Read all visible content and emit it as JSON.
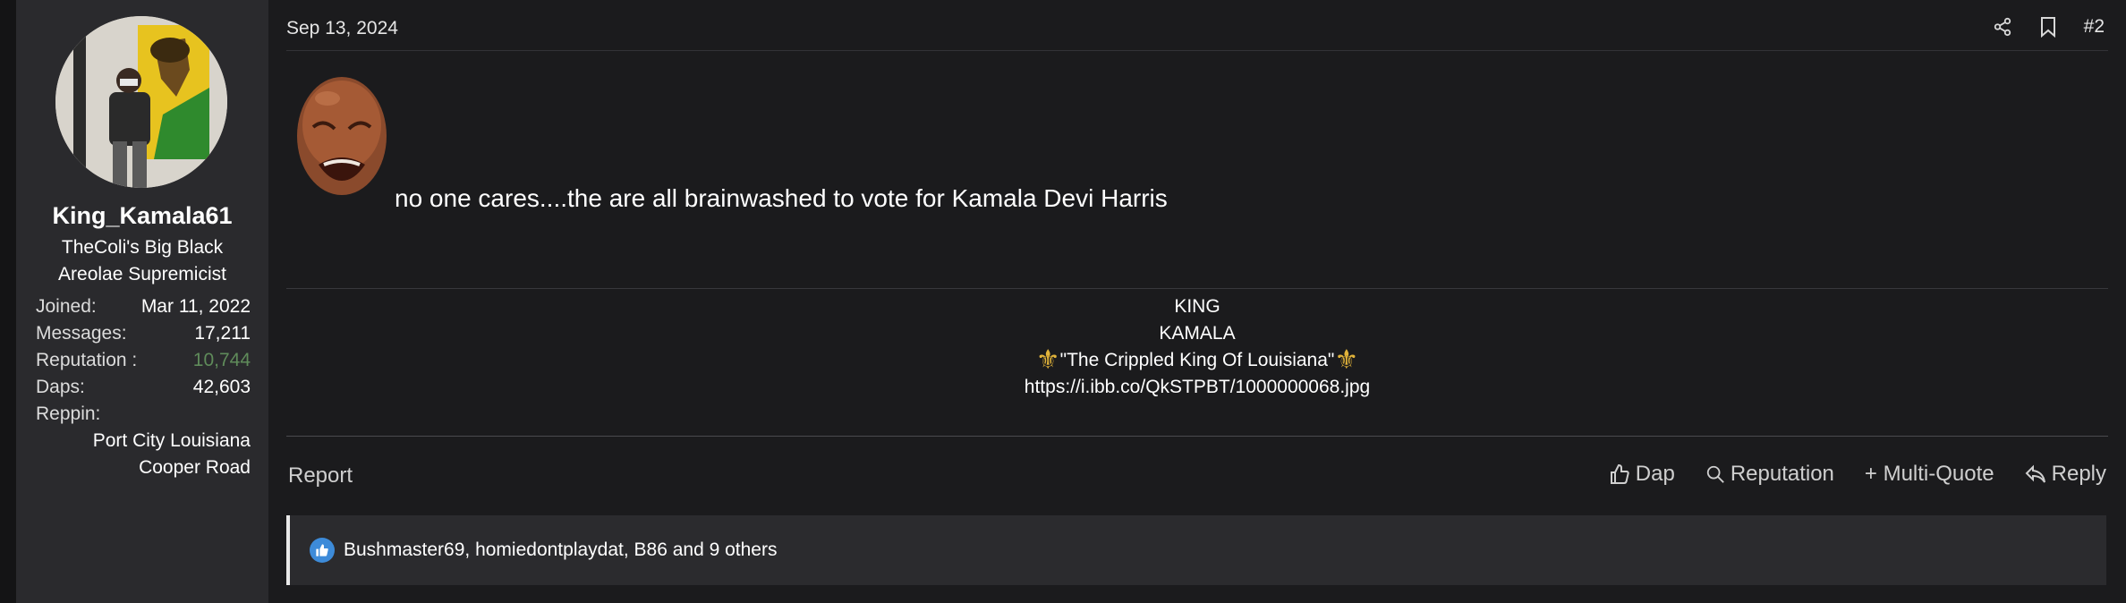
{
  "post": {
    "date": "Sep 13, 2024",
    "number": "#2",
    "body_text": "no one cares....the are all brainwashed to vote for Kamala Devi Harris",
    "emoji": "crying-jordan-face"
  },
  "user": {
    "name": "King_Kamala61",
    "title_line1": "TheColi's Big Black",
    "title_line2": "Areolae Supremicist",
    "joined_label": "Joined:",
    "joined_value": "Mar 11, 2022",
    "messages_label": "Messages:",
    "messages_value": "17,211",
    "reputation_label": "Reputation :",
    "reputation_value": "10,744",
    "daps_label": "Daps:",
    "daps_value": "42,603",
    "reppin_label": "Reppin:",
    "reppin_line1": "Port City Louisiana",
    "reppin_line2": "Cooper Road"
  },
  "signature": {
    "line1": "KING",
    "line2": "KAMALA",
    "line3": "\"The Crippled King Of Louisiana\"",
    "line4": "https://i.ibb.co/QkSTPBT/1000000068.jpg"
  },
  "footer": {
    "report_label": "Report",
    "dap_label": "Dap",
    "reputation_label": "Reputation",
    "multiquote_label": "+ Multi-Quote",
    "reply_label": "Reply"
  },
  "reactions": {
    "text": "Bushmaster69, homiedontplaydat, B86 and 9 others"
  },
  "colors": {
    "background": "#1b1b1d",
    "panel": "#2a2a2d",
    "reputation_green": "#5f8b5a",
    "like_blue": "#3d8bd9",
    "fleur_gold": "#e1b33a"
  },
  "icons": [
    "share-icon",
    "bookmark-icon",
    "thumbs-up-icon",
    "search-icon",
    "reply-icon",
    "like-badge-icon",
    "fleur-de-lis-icon"
  ]
}
